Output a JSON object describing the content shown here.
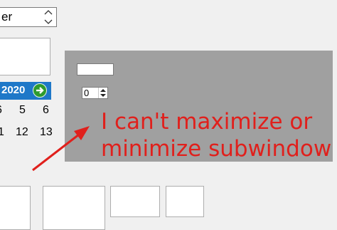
{
  "top_combo": {
    "value": "er"
  },
  "calendar": {
    "header_year": "2020",
    "row1": [
      "6",
      "5",
      "6"
    ],
    "row2": [
      "1",
      "12",
      "13"
    ]
  },
  "subwindow": {
    "spin_value": "0"
  },
  "annotation": {
    "line1": "I can't maximize or",
    "line2": "minimize subwindow",
    "color": "#e0201c"
  },
  "icons": {
    "spin": "up-down-arrows-icon",
    "calendar_next": "right-arrow-icon"
  }
}
